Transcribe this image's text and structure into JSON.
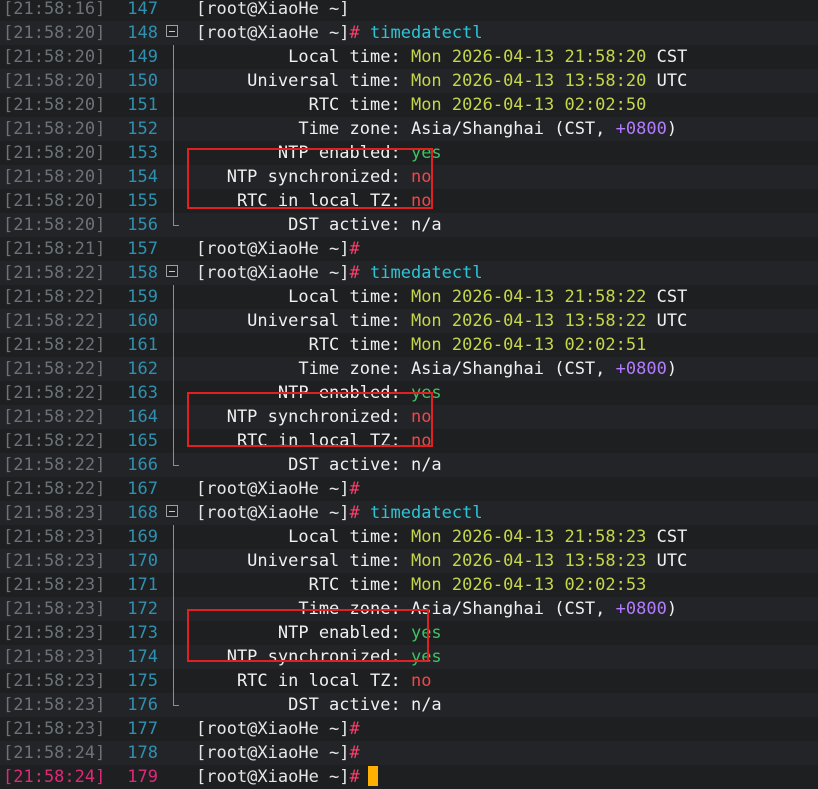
{
  "prompt": {
    "user_host": "[root@XiaoHe ~]",
    "hash": "#"
  },
  "blocks": [
    {
      "ts": "[21:58:20]",
      "last_prompt": {
        "ts": "[21:58:21]",
        "ln": "157"
      },
      "cmd": {
        "ln": "148",
        "text": "timedatectl"
      },
      "lines": [
        {
          "ln": "149",
          "key": "Local time",
          "value": "Mon 2026-04-13 21:58:20",
          "suffix": "CST"
        },
        {
          "ln": "150",
          "key": "Universal time",
          "value": "Mon 2026-04-13 13:58:20",
          "suffix": "UTC"
        },
        {
          "ln": "151",
          "key": "RTC time",
          "value": "Mon 2026-04-13 02:02:50"
        },
        {
          "ln": "152",
          "key": "Time zone",
          "tz": "Asia/Shanghai",
          "tz_abbr": "CST",
          "offset": "+0800"
        },
        {
          "ln": "153",
          "key": "NTP enabled",
          "value": "yes"
        },
        {
          "ln": "154",
          "key": "NTP synchronized",
          "value": "no"
        },
        {
          "ln": "155",
          "key": "RTC in local TZ",
          "value": "no"
        },
        {
          "ln": "156",
          "key": "DST active",
          "value": "n/a"
        }
      ]
    }
  ],
  "rows": [
    {
      "ts": "[21:58:16]",
      "ln": "147",
      "type": "partial",
      "text": "[root@XiaoHe ~]"
    },
    {
      "ts": "[21:58:20]",
      "ln": "148",
      "type": "cmd",
      "gutter": "fold",
      "cmd": "timedatectl"
    },
    {
      "ts": "[21:58:20]",
      "ln": "149",
      "type": "kv",
      "gutter": "line",
      "key": "Local time",
      "pad": "         ",
      "vclass": "val-date",
      "value": "Mon 2026-04-13 21:58:20",
      "suffix": "CST"
    },
    {
      "ts": "[21:58:20]",
      "ln": "150",
      "type": "kv",
      "gutter": "line",
      "key": "Universal time",
      "pad": "     ",
      "vclass": "val-date",
      "value": "Mon 2026-04-13 13:58:20",
      "suffix": "UTC"
    },
    {
      "ts": "[21:58:20]",
      "ln": "151",
      "type": "kv",
      "gutter": "line",
      "key": "RTC time",
      "pad": "           ",
      "vclass": "val-date",
      "value": "Mon 2026-04-13 02:02:50"
    },
    {
      "ts": "[21:58:20]",
      "ln": "152",
      "type": "tz",
      "gutter": "line",
      "key": "Time zone",
      "pad": "          ",
      "tz": "Asia/Shanghai",
      "abbr": "CST",
      "offset": "+0800"
    },
    {
      "ts": "[21:58:20]",
      "ln": "153",
      "type": "kv",
      "gutter": "line",
      "key": "NTP enabled",
      "pad": "        ",
      "vclass": "yes",
      "value": "yes"
    },
    {
      "ts": "[21:58:20]",
      "ln": "154",
      "type": "kv",
      "gutter": "line",
      "key": "NTP synchronized",
      "pad": "   ",
      "vclass": "no",
      "value": "no"
    },
    {
      "ts": "[21:58:20]",
      "ln": "155",
      "type": "kv",
      "gutter": "line",
      "key": "RTC in local TZ",
      "pad": "    ",
      "vclass": "no",
      "value": "no"
    },
    {
      "ts": "[21:58:20]",
      "ln": "156",
      "type": "kv",
      "gutter": "end",
      "key": "DST active",
      "pad": "         ",
      "vclass": "key",
      "value": "n/a"
    },
    {
      "ts": "[21:58:21]",
      "ln": "157",
      "type": "prompt"
    },
    {
      "ts": "[21:58:22]",
      "ln": "158",
      "type": "cmd",
      "gutter": "fold",
      "cmd": "timedatectl"
    },
    {
      "ts": "[21:58:22]",
      "ln": "159",
      "type": "kv",
      "gutter": "line",
      "key": "Local time",
      "pad": "         ",
      "vclass": "val-date",
      "value": "Mon 2026-04-13 21:58:22",
      "suffix": "CST"
    },
    {
      "ts": "[21:58:22]",
      "ln": "160",
      "type": "kv",
      "gutter": "line",
      "key": "Universal time",
      "pad": "     ",
      "vclass": "val-date",
      "value": "Mon 2026-04-13 13:58:22",
      "suffix": "UTC"
    },
    {
      "ts": "[21:58:22]",
      "ln": "161",
      "type": "kv",
      "gutter": "line",
      "key": "RTC time",
      "pad": "           ",
      "vclass": "val-date",
      "value": "Mon 2026-04-13 02:02:51"
    },
    {
      "ts": "[21:58:22]",
      "ln": "162",
      "type": "tz",
      "gutter": "line",
      "key": "Time zone",
      "pad": "          ",
      "tz": "Asia/Shanghai",
      "abbr": "CST",
      "offset": "+0800"
    },
    {
      "ts": "[21:58:22]",
      "ln": "163",
      "type": "kv",
      "gutter": "line",
      "key": "NTP enabled",
      "pad": "        ",
      "vclass": "yes",
      "value": "yes"
    },
    {
      "ts": "[21:58:22]",
      "ln": "164",
      "type": "kv",
      "gutter": "line",
      "key": "NTP synchronized",
      "pad": "   ",
      "vclass": "no",
      "value": "no"
    },
    {
      "ts": "[21:58:22]",
      "ln": "165",
      "type": "kv",
      "gutter": "line",
      "key": "RTC in local TZ",
      "pad": "    ",
      "vclass": "no",
      "value": "no"
    },
    {
      "ts": "[21:58:22]",
      "ln": "166",
      "type": "kv",
      "gutter": "end",
      "key": "DST active",
      "pad": "         ",
      "vclass": "key",
      "value": "n/a"
    },
    {
      "ts": "[21:58:22]",
      "ln": "167",
      "type": "prompt"
    },
    {
      "ts": "[21:58:23]",
      "ln": "168",
      "type": "cmd",
      "gutter": "fold",
      "cmd": "timedatectl"
    },
    {
      "ts": "[21:58:23]",
      "ln": "169",
      "type": "kv",
      "gutter": "line",
      "key": "Local time",
      "pad": "         ",
      "vclass": "val-date",
      "value": "Mon 2026-04-13 21:58:23",
      "suffix": "CST"
    },
    {
      "ts": "[21:58:23]",
      "ln": "170",
      "type": "kv",
      "gutter": "line",
      "key": "Universal time",
      "pad": "     ",
      "vclass": "val-date",
      "value": "Mon 2026-04-13 13:58:23",
      "suffix": "UTC"
    },
    {
      "ts": "[21:58:23]",
      "ln": "171",
      "type": "kv",
      "gutter": "line",
      "key": "RTC time",
      "pad": "           ",
      "vclass": "val-date",
      "value": "Mon 2026-04-13 02:02:53"
    },
    {
      "ts": "[21:58:23]",
      "ln": "172",
      "type": "tz",
      "gutter": "line",
      "key": "Time zone",
      "pad": "          ",
      "tz": "Asia/Shanghai",
      "abbr": "CST",
      "offset": "+0800"
    },
    {
      "ts": "[21:58:23]",
      "ln": "173",
      "type": "kv",
      "gutter": "line",
      "key": "NTP enabled",
      "pad": "        ",
      "vclass": "yes",
      "value": "yes"
    },
    {
      "ts": "[21:58:23]",
      "ln": "174",
      "type": "kv",
      "gutter": "line",
      "key": "NTP synchronized",
      "pad": "   ",
      "vclass": "yes",
      "value": "yes"
    },
    {
      "ts": "[21:58:23]",
      "ln": "175",
      "type": "kv",
      "gutter": "line",
      "key": "RTC in local TZ",
      "pad": "    ",
      "vclass": "no",
      "value": "no"
    },
    {
      "ts": "[21:58:23]",
      "ln": "176",
      "type": "kv",
      "gutter": "end",
      "key": "DST active",
      "pad": "         ",
      "vclass": "key",
      "value": "n/a"
    },
    {
      "ts": "[21:58:23]",
      "ln": "177",
      "type": "prompt"
    },
    {
      "ts": "[21:58:24]",
      "ln": "178",
      "type": "prompt"
    },
    {
      "ts": "[21:58:24]",
      "ln": "179",
      "type": "prompt",
      "current": true
    }
  ],
  "colors": {
    "highlight_box": "#e12121",
    "cursor": "#ffb000",
    "line_number": "#2f90b0",
    "current_line": "#e0287a",
    "date_value": "#c6d64a",
    "yes_value": "#3dc463",
    "no_value": "#f0484a"
  },
  "icons": {
    "fold": "fold-toggle-icon",
    "cursor": "block-cursor-icon"
  }
}
